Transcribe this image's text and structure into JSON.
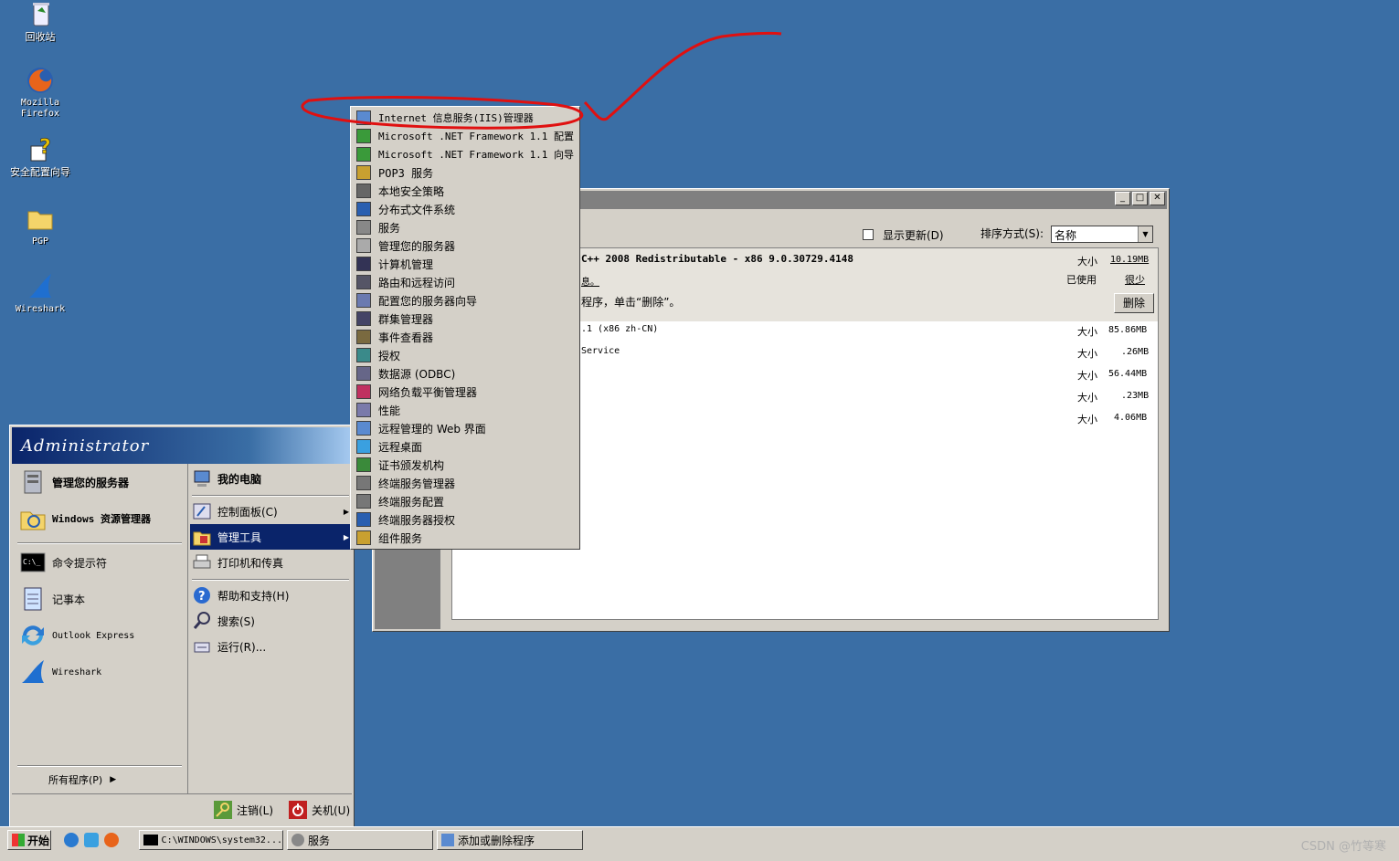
{
  "desktop": {
    "icons": [
      {
        "label": "回收站"
      },
      {
        "label": "Mozilla Firefox"
      },
      {
        "label": "安全配置向导"
      },
      {
        "label": "PGP"
      },
      {
        "label": "Wireshark"
      }
    ]
  },
  "window": {
    "show_updates_label": "显示更新(D)",
    "sort_label": "排序方式(S):",
    "sort_value": "名称",
    "selected": {
      "name": "C++ 2008 Redistributable - x86 9.0.30729.4148",
      "size_label": "大小",
      "size_value": "10.19MB",
      "used_label": "已使用",
      "used_value": "很少",
      "link_fragment": "息。",
      "hint": "程序，单击“删除”。",
      "remove_button": "删除"
    },
    "rows": [
      {
        "name": ".1 (x86 zh-CN)",
        "size_label": "大小",
        "size": "85.86MB"
      },
      {
        "name": "Service",
        "size_label": "大小",
        "size": ".26MB"
      },
      {
        "name": "",
        "size_label": "大小",
        "size": "56.44MB"
      },
      {
        "name": "",
        "size_label": "大小",
        "size": ".23MB"
      },
      {
        "name": "",
        "size_label": "大小",
        "size": "4.06MB"
      }
    ]
  },
  "start_menu": {
    "user": "Administrator",
    "left_pinned": [
      {
        "label": "管理您的服务器"
      },
      {
        "label": "Windows 资源管理器"
      }
    ],
    "left_recent": [
      {
        "label": "命令提示符"
      },
      {
        "label": "记事本"
      },
      {
        "label": "Outlook Express"
      },
      {
        "label": "Wireshark"
      }
    ],
    "all_programs": "所有程序(P)",
    "right": {
      "my_computer": "我的电脑",
      "control_panel": "控制面板(C)",
      "admin_tools": "管理工具",
      "printers": "打印机和传真",
      "help": "帮助和支持(H)",
      "search": "搜索(S)",
      "run": "运行(R)..."
    },
    "logoff": "注销(L)",
    "shutdown": "关机(U)"
  },
  "admin_submenu": {
    "items": [
      "Internet 信息服务(IIS)管理器",
      "Microsoft .NET Framework 1.1 配置",
      "Microsoft .NET Framework 1.1 向导",
      "POP3 服务",
      "本地安全策略",
      "分布式文件系统",
      "服务",
      "管理您的服务器",
      "计算机管理",
      "路由和远程访问",
      "配置您的服务器向导",
      "群集管理器",
      "事件查看器",
      "授权",
      "数据源 (ODBC)",
      "网络负载平衡管理器",
      "性能",
      "远程管理的 Web 界面",
      "远程桌面",
      "证书颁发机构",
      "终端服务管理器",
      "终端服务配置",
      "终端服务器授权",
      "组件服务"
    ]
  },
  "taskbar": {
    "start": "开始",
    "tasks": [
      {
        "label": "C:\\WINDOWS\\system32..."
      },
      {
        "label": "服务"
      },
      {
        "label": "添加或删除程序"
      }
    ]
  },
  "watermark": "CSDN @竹等寒",
  "colors": {
    "desktop": "#3a6ea5",
    "highlight": "#0a246a",
    "annotation": "#e01010"
  }
}
